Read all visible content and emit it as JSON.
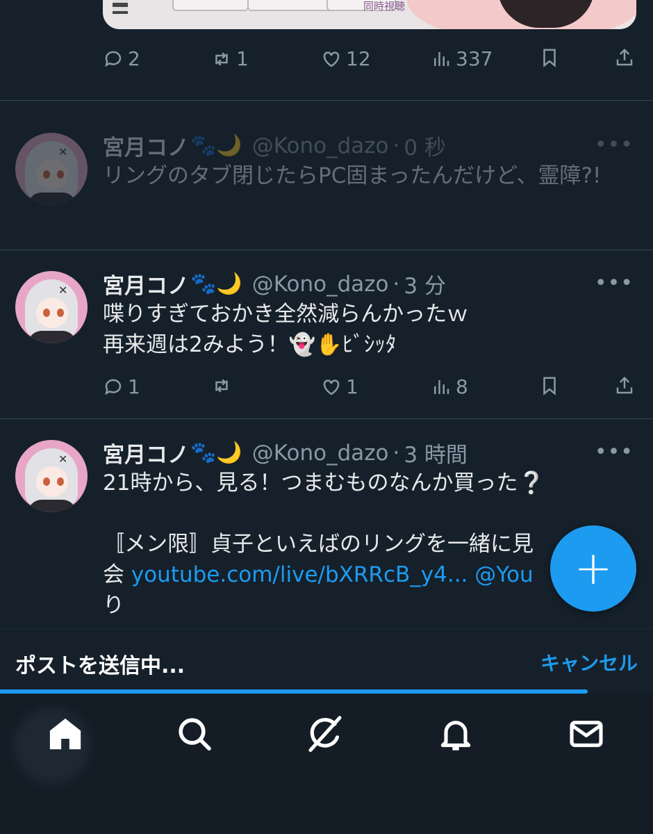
{
  "previous_tweet": {
    "media_caption": "同時視聴",
    "stats": {
      "replies": "2",
      "reposts": "1",
      "likes": "12",
      "views": "337"
    }
  },
  "tweets": [
    {
      "name": "宮月コノ",
      "emoji": "🐾🌙",
      "handle": "@Kono_dazo",
      "time": "0 秒",
      "lines": [
        "リングのタブ閉じたらPC固まったんだけど、霊障?!"
      ],
      "more": "•••",
      "state": "sending"
    },
    {
      "name": "宮月コノ",
      "emoji": "🐾🌙",
      "handle": "@Kono_dazo",
      "time": "3 分",
      "lines": [
        "喋りすぎておかき全然減らんかったｗ",
        "再来週は2みよう！👻✋ﾋﾞｼｯﾀ"
      ],
      "more": "•••",
      "stats": {
        "replies": "1",
        "reposts": "",
        "likes": "1",
        "views": "8"
      }
    },
    {
      "name": "宮月コノ",
      "emoji": "🐾🌙",
      "handle": "@Kono_dazo",
      "time": "3 時間",
      "lines": [
        "21時から、見る！つまむものなんか買った❔",
        "",
        "〚メン限〛貞子といえばのリングを一緒に見",
        "会",
        "り"
      ],
      "link": "youtube.com/live/bXRRcB_y4...",
      "mention": "@You",
      "more": "•••"
    }
  ],
  "fab": {
    "label": "+"
  },
  "status_bar": {
    "sending_text": "ポストを送信中...",
    "cancel_label": "キャンセル",
    "progress": 0.9
  },
  "bottom_nav": {
    "items": [
      "home-icon",
      "search-icon",
      "grok-icon",
      "notifications-icon",
      "messages-icon"
    ]
  },
  "colors": {
    "background": "#15202b",
    "accent": "#1d9bf0",
    "muted": "#8b98a5",
    "divider": "#38444d"
  }
}
